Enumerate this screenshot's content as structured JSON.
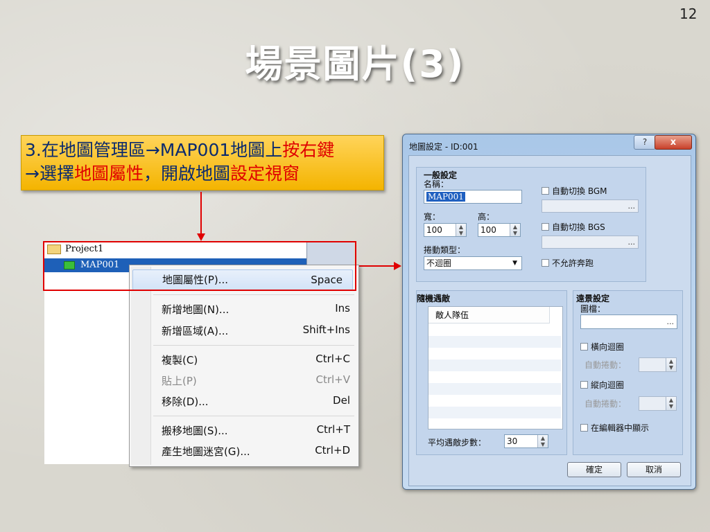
{
  "slide": {
    "number": "12",
    "title": "場景圖片(3)"
  },
  "callout": {
    "line1_a": "3.在地圖管理區→MAP001地圖上",
    "line1_b": "按右鍵",
    "line2_a": "→選擇",
    "line2_b": "地圖屬性",
    "line2_c": "，開啟地圖",
    "line2_d": "設定視窗",
    "accent_color": "#e00000",
    "background_color": "#f4b400"
  },
  "tree": {
    "root": "Project1",
    "selected": "MAP001"
  },
  "context_menu": {
    "items": [
      {
        "label": "地圖屬性(P)...",
        "shortcut": "Space",
        "highlighted": true,
        "disabled": false
      },
      {
        "label": "新增地圖(N)...",
        "shortcut": "Ins",
        "highlighted": false,
        "disabled": false
      },
      {
        "label": "新增區域(A)...",
        "shortcut": "Shift+Ins",
        "highlighted": false,
        "disabled": false
      },
      {
        "label": "複製(C)",
        "shortcut": "Ctrl+C",
        "highlighted": false,
        "disabled": false
      },
      {
        "label": "貼上(P)",
        "shortcut": "Ctrl+V",
        "highlighted": false,
        "disabled": true
      },
      {
        "label": "移除(D)...",
        "shortcut": "Del",
        "highlighted": false,
        "disabled": false
      },
      {
        "label": "搬移地圖(S)...",
        "shortcut": "Ctrl+T",
        "highlighted": false,
        "disabled": false
      },
      {
        "label": "產生地圖迷宮(G)...",
        "shortcut": "Ctrl+D",
        "highlighted": false,
        "disabled": false
      }
    ]
  },
  "dialog": {
    "title": "地圖設定 - ID:001",
    "help": "?",
    "close": "x",
    "general": {
      "header": "一般設定",
      "name_label": "名稱：",
      "name_value": "MAP001",
      "width_label": "寬：",
      "width_value": "100",
      "height_label": "高：",
      "height_value": "100",
      "scroll_label": "捲動類型：",
      "scroll_value": "不迴圈",
      "auto_bgm": "自動切換 BGM",
      "auto_bgs": "自動切換 BGS",
      "no_dash": "不允許奔跑",
      "browse": "..."
    },
    "encounters": {
      "header": "隨機遇敵",
      "column": "敵人隊伍",
      "avg_steps_label": "平均遇敵步數：",
      "avg_steps_value": "30"
    },
    "parallax": {
      "header": "遠景設定",
      "image_label": "圖檔：",
      "browse": "...",
      "h_loop": "橫向迴圈",
      "auto_scroll_1": "自動捲動：",
      "v_loop": "縱向迴圈",
      "auto_scroll_2": "自動捲動：",
      "show_in_editor": "在編輯器中顯示"
    },
    "ok": "確定",
    "cancel": "取消"
  }
}
